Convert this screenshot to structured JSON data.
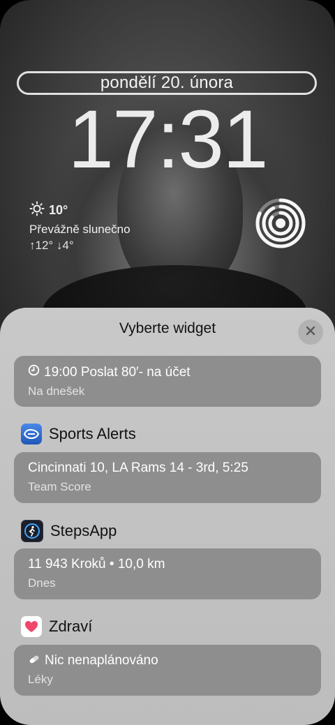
{
  "lockscreen": {
    "date": "pondělí 20. února",
    "time": "17:31",
    "weather": {
      "temperature": "10°",
      "condition": "Převážně slunečno",
      "range": "↑12° ↓4°",
      "icon": "sun-icon"
    },
    "activity_icon": "activity-rings-icon"
  },
  "sheet": {
    "title": "Vyberte widget",
    "close_icon": "close-icon"
  },
  "widgets": {
    "reminder": {
      "icon": "clock-icon",
      "title": "19:00 Poslat 80′- na účet",
      "subtitle": "Na dnešek"
    },
    "sports_alerts": {
      "app_name": "Sports Alerts",
      "icon": "sports-alerts-app-icon",
      "title": "Cincinnati 10, LA Rams 14 - 3rd,  5:25",
      "subtitle": "Team Score"
    },
    "steps_app": {
      "app_name": "StepsApp",
      "icon": "stepsapp-app-icon",
      "title": "11 943 Kroků • 10,0 km",
      "subtitle": "Dnes"
    },
    "health": {
      "app_name": "Zdraví",
      "icon": "health-app-icon",
      "pill_icon": "pill-icon",
      "title": "Nic nenaplánováno",
      "subtitle": "Léky"
    }
  },
  "colors": {
    "sheet_background": "#c3c3c3",
    "card_background": "#8e8e8e",
    "sports_icon_blue": "#2f6fd3",
    "health_heart": "#f0466a"
  }
}
